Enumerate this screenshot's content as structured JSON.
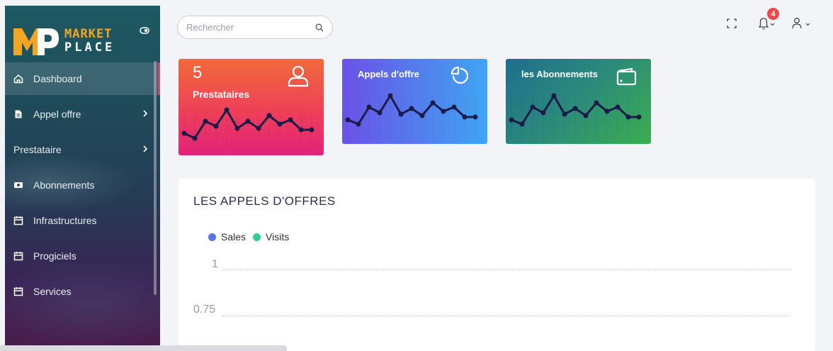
{
  "brand": {
    "line1": "MARKET",
    "line2": "PLACE",
    "accent": "#f5a524"
  },
  "sidebar": {
    "items": [
      {
        "label": "Dashboard",
        "icon": "home-icon",
        "active": true
      },
      {
        "label": "Appel offre",
        "icon": "file-icon",
        "has_submenu": true
      },
      {
        "label": "Prestataire",
        "icon": "",
        "has_submenu": true
      },
      {
        "label": "Abonnements",
        "icon": "money-icon"
      },
      {
        "label": "Infrastructures",
        "icon": "calendar-icon"
      },
      {
        "label": "Progiciels",
        "icon": "calendar-icon"
      },
      {
        "label": "Services",
        "icon": "calendar-icon"
      }
    ]
  },
  "search": {
    "placeholder": "Rechercher"
  },
  "notifications": {
    "count": "4",
    "badge_color": "#ef4747"
  },
  "cards": [
    {
      "value": "5",
      "label": "Prestataires",
      "icon": "user-icon"
    },
    {
      "label": "Appels d'offre",
      "icon": "pie-chart-icon"
    },
    {
      "label": "les Abonnements",
      "icon": "wallet-icon"
    }
  ],
  "panel": {
    "title": "LES APPELS D'OFFRES",
    "legend": [
      {
        "name": "Sales",
        "color": "#5b72e8"
      },
      {
        "name": "Visits",
        "color": "#2ccf9a"
      }
    ],
    "ticks": [
      "1",
      "0.75"
    ]
  }
}
